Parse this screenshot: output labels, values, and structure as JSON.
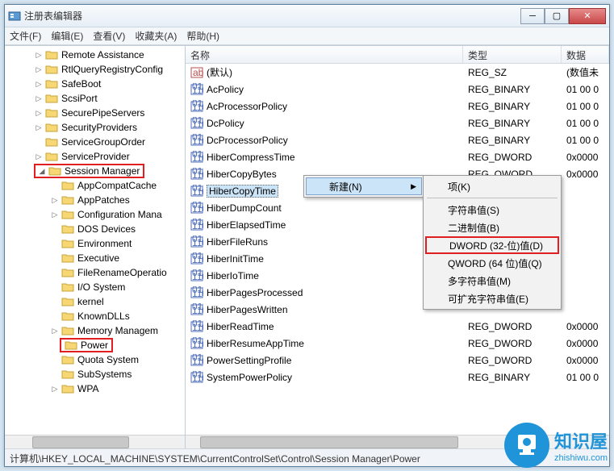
{
  "window": {
    "title": "注册表编辑器"
  },
  "menu": {
    "file": "文件(F)",
    "edit": "编辑(E)",
    "view": "查看(V)",
    "favorites": "收藏夹(A)",
    "help": "帮助(H)"
  },
  "tree": {
    "items": [
      {
        "label": "Remote Assistance",
        "indent": 0,
        "exp": "▷"
      },
      {
        "label": "RtlQueryRegistryConfig",
        "indent": 0,
        "exp": "▷"
      },
      {
        "label": "SafeBoot",
        "indent": 0,
        "exp": "▷"
      },
      {
        "label": "ScsiPort",
        "indent": 0,
        "exp": "▷"
      },
      {
        "label": "SecurePipeServers",
        "indent": 0,
        "exp": "▷"
      },
      {
        "label": "SecurityProviders",
        "indent": 0,
        "exp": "▷"
      },
      {
        "label": "ServiceGroupOrder",
        "indent": 0,
        "exp": ""
      },
      {
        "label": "ServiceProvider",
        "indent": 0,
        "exp": "▷"
      },
      {
        "label": "Session Manager",
        "indent": 0,
        "exp": "◢",
        "redbox": true,
        "showexp": true
      },
      {
        "label": "AppCompatCache",
        "indent": 1,
        "exp": ""
      },
      {
        "label": "AppPatches",
        "indent": 1,
        "exp": "▷"
      },
      {
        "label": "Configuration Mana",
        "indent": 1,
        "exp": "▷"
      },
      {
        "label": "DOS Devices",
        "indent": 1,
        "exp": ""
      },
      {
        "label": "Environment",
        "indent": 1,
        "exp": ""
      },
      {
        "label": "Executive",
        "indent": 1,
        "exp": ""
      },
      {
        "label": "FileRenameOperatio",
        "indent": 1,
        "exp": ""
      },
      {
        "label": "I/O System",
        "indent": 1,
        "exp": ""
      },
      {
        "label": "kernel",
        "indent": 1,
        "exp": ""
      },
      {
        "label": "KnownDLLs",
        "indent": 1,
        "exp": ""
      },
      {
        "label": "Memory Managem",
        "indent": 1,
        "exp": "▷"
      },
      {
        "label": "Power",
        "indent": 1,
        "exp": "",
        "redbox": true
      },
      {
        "label": "Quota System",
        "indent": 1,
        "exp": ""
      },
      {
        "label": "SubSystems",
        "indent": 1,
        "exp": ""
      },
      {
        "label": "WPA",
        "indent": 1,
        "exp": "▷"
      }
    ]
  },
  "list": {
    "columns": {
      "name": "名称",
      "type": "类型",
      "data": "数据"
    },
    "rows": [
      {
        "icon": "str",
        "name": "(默认)",
        "type": "REG_SZ",
        "data": "(数值未"
      },
      {
        "icon": "bin",
        "name": "AcPolicy",
        "type": "REG_BINARY",
        "data": "01 00 0"
      },
      {
        "icon": "bin",
        "name": "AcProcessorPolicy",
        "type": "REG_BINARY",
        "data": "01 00 0"
      },
      {
        "icon": "bin",
        "name": "DcPolicy",
        "type": "REG_BINARY",
        "data": "01 00 0"
      },
      {
        "icon": "bin",
        "name": "DcProcessorPolicy",
        "type": "REG_BINARY",
        "data": "01 00 0"
      },
      {
        "icon": "bin",
        "name": "HiberCompressTime",
        "type": "REG_DWORD",
        "data": "0x0000"
      },
      {
        "icon": "bin",
        "name": "HiberCopyBytes",
        "type": "REG_QWORD",
        "data": "0x0000"
      },
      {
        "icon": "bin",
        "name": "HiberCopyTime",
        "type": "",
        "data": "",
        "selected": true
      },
      {
        "icon": "bin",
        "name": "HiberDumpCount",
        "type": "",
        "data": ""
      },
      {
        "icon": "bin",
        "name": "HiberElapsedTime",
        "type": "",
        "data": ""
      },
      {
        "icon": "bin",
        "name": "HiberFileRuns",
        "type": "",
        "data": ""
      },
      {
        "icon": "bin",
        "name": "HiberInitTime",
        "type": "",
        "data": ""
      },
      {
        "icon": "bin",
        "name": "HiberIoTime",
        "type": "",
        "data": ""
      },
      {
        "icon": "bin",
        "name": "HiberPagesProcessed",
        "type": "",
        "data": ""
      },
      {
        "icon": "bin",
        "name": "HiberPagesWritten",
        "type": "",
        "data": ""
      },
      {
        "icon": "bin",
        "name": "HiberReadTime",
        "type": "REG_DWORD",
        "data": "0x0000"
      },
      {
        "icon": "bin",
        "name": "HiberResumeAppTime",
        "type": "REG_DWORD",
        "data": "0x0000"
      },
      {
        "icon": "bin",
        "name": "PowerSettingProfile",
        "type": "REG_DWORD",
        "data": "0x0000"
      },
      {
        "icon": "bin",
        "name": "SystemPowerPolicy",
        "type": "REG_BINARY",
        "data": "01 00 0"
      }
    ]
  },
  "context": {
    "new": "新建(N)",
    "submenu": {
      "key": "项(K)",
      "string": "字符串值(S)",
      "binary": "二进制值(B)",
      "dword": "DWORD (32-位)值(D)",
      "qword": "QWORD (64 位)值(Q)",
      "multi": "多字符串值(M)",
      "expand": "可扩充字符串值(E)"
    }
  },
  "statusbar": "计算机\\HKEY_LOCAL_MACHINE\\SYSTEM\\CurrentControlSet\\Control\\Session Manager\\Power",
  "watermark": {
    "brand": "知识屋",
    "url": "zhishiwu.com"
  }
}
